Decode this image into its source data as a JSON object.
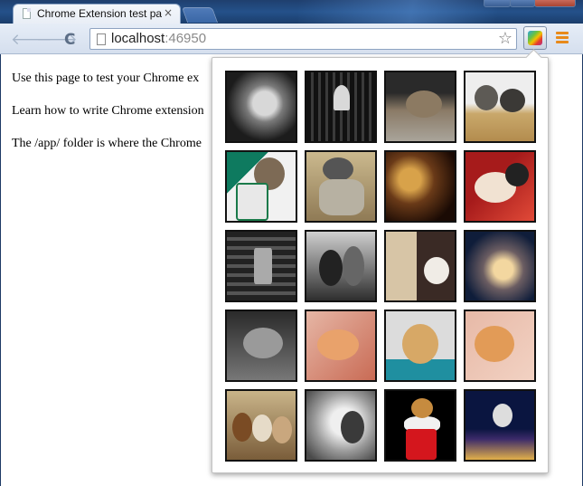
{
  "window": {
    "tab_title": "Chrome Extension test pag",
    "tab_close": "×"
  },
  "toolbar": {
    "back": "🡐",
    "forward": "🡒",
    "reload": "C",
    "url_host": "localhost",
    "url_port": ":46950",
    "bookmark_star": "☆"
  },
  "page": {
    "line1": "Use this page to test your Chrome ex",
    "line2": "Learn how to write Chrome extension",
    "line3": "The /app/ folder is where the Chrome"
  },
  "popup": {
    "images": [
      {
        "name": "image-1"
      },
      {
        "name": "image-2"
      },
      {
        "name": "image-3"
      },
      {
        "name": "image-4"
      },
      {
        "name": "image-5"
      },
      {
        "name": "image-6"
      },
      {
        "name": "image-7"
      },
      {
        "name": "image-8"
      },
      {
        "name": "image-9"
      },
      {
        "name": "image-10"
      },
      {
        "name": "image-11"
      },
      {
        "name": "image-12"
      },
      {
        "name": "image-13"
      },
      {
        "name": "image-14"
      },
      {
        "name": "image-15"
      },
      {
        "name": "image-16"
      },
      {
        "name": "image-17"
      },
      {
        "name": "image-18"
      },
      {
        "name": "image-19"
      },
      {
        "name": "image-20"
      }
    ]
  }
}
